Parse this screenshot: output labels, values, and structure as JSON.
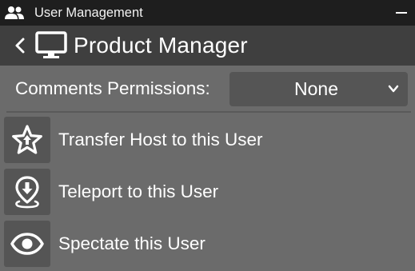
{
  "window": {
    "title": "User Management",
    "icon": "users-icon",
    "minimize_icon": "minimize-icon"
  },
  "header": {
    "back_icon": "chevron-left-icon",
    "title_icon": "monitor-icon",
    "title": "Product Manager"
  },
  "permissions": {
    "label": "Comments Permissions:",
    "selected": "None",
    "dropdown_icon": "chevron-down-icon"
  },
  "actions": [
    {
      "label": "Transfer Host to this User",
      "icon": "star-transfer-icon"
    },
    {
      "label": "Teleport to this User",
      "icon": "location-pin-icon"
    },
    {
      "label": "Spectate this User",
      "icon": "eye-icon"
    }
  ],
  "colors": {
    "titlebar_bg": "#1e1e1e",
    "header_bg": "#3f3f3f",
    "body_bg": "#6b6b6b",
    "control_bg": "#555555",
    "text": "#ffffff"
  }
}
